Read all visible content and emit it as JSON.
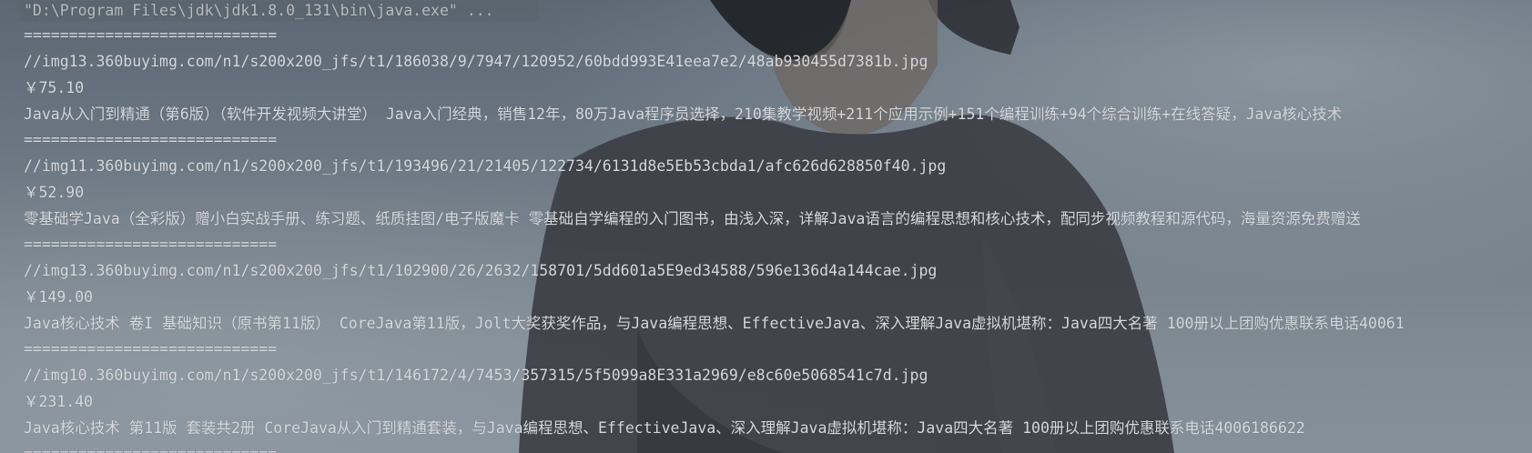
{
  "console": {
    "command": "\"D:\\Program Files\\jdk\\jdk1.8.0_131\\bin\\java.exe\" ...",
    "separator": "============================",
    "records": [
      {
        "url": "//img13.360buyimg.com/n1/s200x200_jfs/t1/186038/9/7947/120952/60bdd993E41eea7e2/48ab930455d7381b.jpg",
        "price": "￥75.10",
        "title": "Java从入门到精通（第6版）（软件开发视频大讲堂） Java入门经典，销售12年，80万Java程序员选择，210集教学视频+211个应用示例+151个编程训练+94个综合训练+在线答疑，Java核心技术"
      },
      {
        "url": "//img11.360buyimg.com/n1/s200x200_jfs/t1/193496/21/21405/122734/6131d8e5Eb53cbda1/afc626d628850f40.jpg",
        "price": "￥52.90",
        "title": "零基础学Java（全彩版）赠小白实战手册、练习题、纸质挂图/电子版魔卡 零基础自学编程的入门图书，由浅入深，详解Java语言的编程思想和核心技术，配同步视频教程和源代码，海量资源免费赠送"
      },
      {
        "url": "//img13.360buyimg.com/n1/s200x200_jfs/t1/102900/26/2632/158701/5dd601a5E9ed34588/596e136d4a144cae.jpg",
        "price": "￥149.00",
        "title": "Java核心技术 卷I 基础知识（原书第11版） CoreJava第11版，Jolt大奖获奖作品，与Java编程思想、EffectiveJava、深入理解Java虚拟机堪称：Java四大名著 100册以上团购优惠联系电话40061"
      },
      {
        "url": "//img10.360buyimg.com/n1/s200x200_jfs/t1/146172/4/7453/357315/5f5099a8E331a2969/e8c60e5068541c7d.jpg",
        "price": "￥231.40",
        "title": "Java核心技术 第11版 套装共2册 CoreJava从入门到精通套装，与Java编程思想、EffectiveJava、深入理解Java虚拟机堪称：Java四大名著 100册以上团购优惠联系电话4006186622"
      }
    ],
    "trailing_separator": "============================"
  },
  "colors": {
    "text": "#d6d9dc",
    "command_text": "#b8bcc0"
  }
}
